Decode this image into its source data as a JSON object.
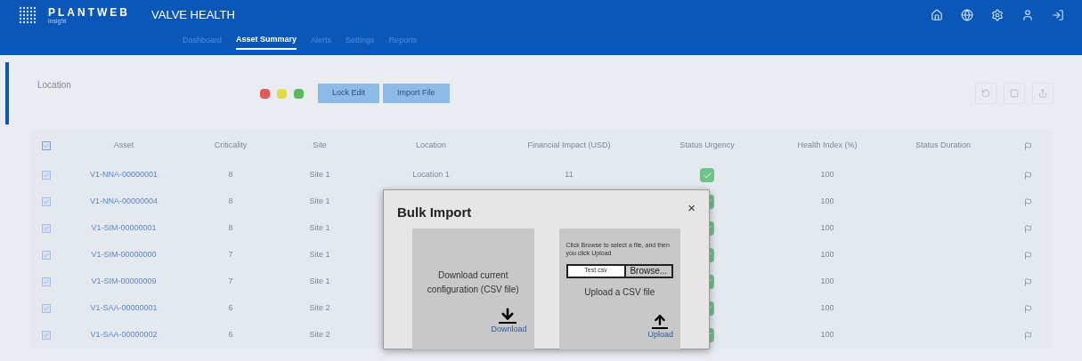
{
  "header": {
    "brand": "PLANTWEB",
    "brand_sub": "insight",
    "app_title": "VALVE HEALTH"
  },
  "nav": [
    {
      "label": "Dashboard",
      "selected": false
    },
    {
      "label": "Asset Summary",
      "selected": true
    },
    {
      "label": "Alerts",
      "selected": false
    },
    {
      "label": "Settings",
      "selected": false
    },
    {
      "label": "Reports",
      "selected": false
    }
  ],
  "toolbar": {
    "location_label": "Location",
    "filters": [
      {
        "color": "#e05a5a"
      },
      {
        "color": "#e6d84a"
      },
      {
        "color": "#5cb85c"
      }
    ],
    "buttons": [
      "Lock Edit",
      "Import File"
    ]
  },
  "table": {
    "all_checked": true,
    "columns": [
      "Asset",
      "Criticality",
      "Site",
      "Location",
      "Financial Impact (USD)",
      "Status Urgency",
      "Health Index (%)",
      "Status Duration"
    ],
    "rows": [
      {
        "checked": true,
        "asset": "V1-NNA-00000001",
        "criticality": "8",
        "site": "Site 1",
        "location": "Location 1",
        "financial_impact": "11",
        "urgency_ok": true,
        "health": "100"
      },
      {
        "checked": true,
        "asset": "V1-NNA-00000004",
        "criticality": "8",
        "site": "Site 1",
        "urgency_ok": true,
        "health": "100"
      },
      {
        "checked": true,
        "asset": "V1-SIM-00000001",
        "criticality": "8",
        "site": "Site 1",
        "urgency_ok": true,
        "health": "100"
      },
      {
        "checked": true,
        "asset": "V1-SIM-00000000",
        "criticality": "7",
        "site": "Site 1",
        "urgency_ok": true,
        "health": "100"
      },
      {
        "checked": true,
        "asset": "V1-SIM-00000009",
        "criticality": "7",
        "site": "Site 1",
        "urgency_ok": true,
        "health": "100"
      },
      {
        "checked": true,
        "asset": "V1-SAA-00000001",
        "criticality": "6",
        "site": "Site 2",
        "urgency_ok": true,
        "health": "100"
      },
      {
        "checked": true,
        "asset": "V1-SAA-00000002",
        "criticality": "6",
        "site": "Site 2",
        "urgency_ok": true,
        "health": "100"
      }
    ]
  },
  "dialog": {
    "title": "Bulk Import",
    "close": "×",
    "download": {
      "text": "Download current configuration (CSV file)",
      "link": "Download"
    },
    "upload": {
      "instructions": "Click Browse to select a file, and then you click Upload",
      "file_value": "Test.csv",
      "browse": "Browse...",
      "text": "Upload a CSV file",
      "link": "Upload"
    }
  }
}
